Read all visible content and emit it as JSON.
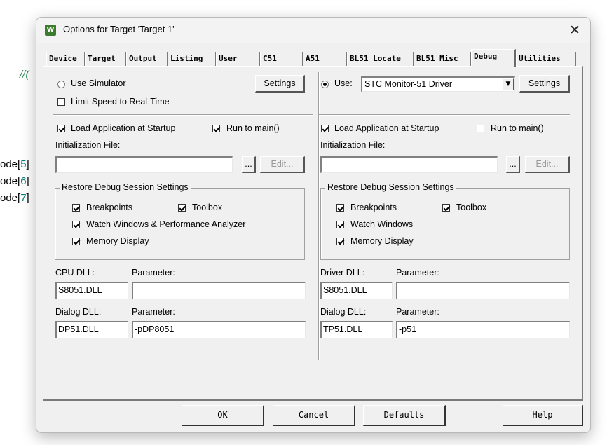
{
  "background": {
    "comment_fragment": "//(",
    "code_lines": [
      {
        "prefix": "ode[",
        "num": "5",
        "suffix": "]"
      },
      {
        "prefix": "ode[",
        "num": "6",
        "suffix": "]"
      },
      {
        "prefix": "ode[",
        "num": "7",
        "suffix": "]"
      }
    ]
  },
  "window": {
    "title": "Options for Target 'Target 1'",
    "icon_letter": "W",
    "close": "✕"
  },
  "tabs": [
    {
      "label": "Device"
    },
    {
      "label": "Target"
    },
    {
      "label": "Output"
    },
    {
      "label": "Listing"
    },
    {
      "label": "User"
    },
    {
      "label": "C51"
    },
    {
      "label": "A51"
    },
    {
      "label": "BL51 Locate"
    },
    {
      "label": "BL51 Misc"
    },
    {
      "label": "Debug",
      "active": true
    },
    {
      "label": "Utilities"
    }
  ],
  "left": {
    "use_simulator": "Use Simulator",
    "settings": "Settings",
    "limit_speed": "Limit Speed to Real-Time",
    "load_app": "Load Application at Startup",
    "run_to_main": "Run to main()",
    "init_file_label": "Initialization File:",
    "init_file_value": "",
    "browse": "...",
    "edit": "Edit...",
    "restore_group": "Restore Debug Session Settings",
    "breakpoints": "Breakpoints",
    "toolbox": "Toolbox",
    "watch_windows": "Watch Windows & Performance Analyzer",
    "memory_display": "Memory Display",
    "dll1_label": "CPU DLL:",
    "param1_label": "Parameter:",
    "dll1_value": "S8051.DLL",
    "param1_value": "",
    "dll2_label": "Dialog DLL:",
    "param2_label": "Parameter:",
    "dll2_value": "DP51.DLL",
    "param2_value": "-pDP8051"
  },
  "right": {
    "use": "Use:",
    "driver": "STC Monitor-51 Driver",
    "settings": "Settings",
    "load_app": "Load Application at Startup",
    "run_to_main": "Run to main()",
    "init_file_label": "Initialization File:",
    "init_file_value": "",
    "browse": "...",
    "edit": "Edit...",
    "restore_group": "Restore Debug Session Settings",
    "breakpoints": "Breakpoints",
    "toolbox": "Toolbox",
    "watch_windows": "Watch Windows",
    "memory_display": "Memory Display",
    "dll1_label": "Driver DLL:",
    "param1_label": "Parameter:",
    "dll1_value": "S8051.DLL",
    "param1_value": "",
    "dll2_label": "Dialog DLL:",
    "param2_label": "Parameter:",
    "dll2_value": "TP51.DLL",
    "param2_value": "-p51"
  },
  "footer": {
    "ok": "OK",
    "cancel": "Cancel",
    "defaults": "Defaults",
    "help": "Help"
  }
}
